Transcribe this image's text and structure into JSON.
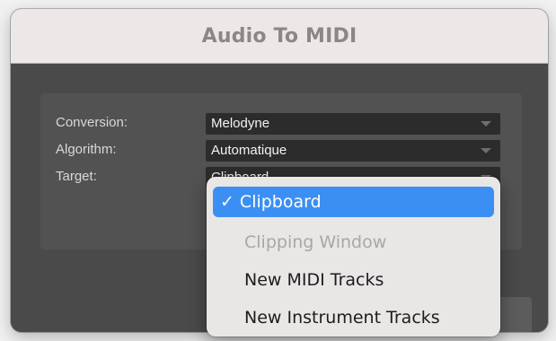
{
  "dialog": {
    "title": "Audio To MIDI"
  },
  "form": {
    "conversion_label": "Conversion:",
    "conversion_value": "Melodyne",
    "algorithm_label": "Algorithm:",
    "algorithm_value": "Automatique",
    "target_label": "Target:",
    "target_value": "Clipboard"
  },
  "target_menu": {
    "check_glyph": "✓",
    "items": [
      {
        "label": "Clipboard",
        "selected": true,
        "enabled": true
      },
      {
        "label": "Clipping Window",
        "selected": false,
        "enabled": false
      },
      {
        "label": "New MIDI Tracks",
        "selected": false,
        "enabled": true
      },
      {
        "label": "New Instrument Tracks",
        "selected": false,
        "enabled": true
      }
    ]
  },
  "colors": {
    "accent": "#3b8ff2",
    "dialog_body": "#4a4a4a",
    "titlebar": "#ede8e8"
  }
}
